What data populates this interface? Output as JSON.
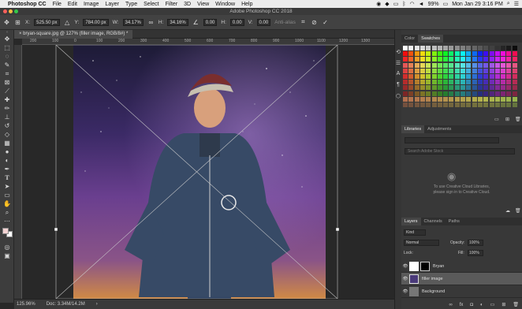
{
  "menubar": {
    "app": "Photoshop CC",
    "items": [
      "File",
      "Edit",
      "Image",
      "Layer",
      "Type",
      "Select",
      "Filter",
      "3D",
      "View",
      "Window",
      "Help"
    ],
    "battery": "99%",
    "clock": "Mon Jan 29  3:16 PM"
  },
  "window": {
    "title": "Adobe Photoshop CC 2018"
  },
  "options": {
    "x_label": "X:",
    "x_value": "525.50 px",
    "y_label": "Y:",
    "y_value": "784.00 px",
    "w_label": "W:",
    "w_value": "34.17%",
    "h_label": "H:",
    "h_value": "34.16%",
    "angle_value": "0.00",
    "h_skew_label": "H:",
    "h_skew_value": "0.00",
    "v_skew_label": "V:",
    "v_skew_value": "0.00",
    "interp_label": "Anti-alias"
  },
  "document": {
    "tab_label": "bryan-square.jpg @ 127% (filler image, RGB/8#) *",
    "zoom": "125.96%",
    "doc_size": "Doc: 3.34M/14.2M"
  },
  "rulers": {
    "h_ticks": [
      "200",
      "100",
      "0",
      "100",
      "200",
      "300",
      "400",
      "500",
      "600",
      "700",
      "800",
      "900",
      "1000",
      "1100",
      "1200",
      "1300"
    ]
  },
  "panels": {
    "color_tab": "Color",
    "swatches_tab": "Swatches",
    "libraries_tab": "Libraries",
    "adjustments_tab": "Adjustments",
    "search_placeholder": "Search Adobe Stock",
    "cc_message_1": "To use Creative Cloud Libraries,",
    "cc_message_2": "please sign in to Creative Cloud.",
    "layers_tab": "Layers",
    "channels_tab": "Channels",
    "paths_tab": "Paths",
    "kind_filter": "Kind",
    "blend_mode": "Normal",
    "opacity_label": "Opacity:",
    "opacity_value": "100%",
    "lock_label": "Lock:",
    "fill_label": "Fill:",
    "fill_value": "100%"
  },
  "layers": [
    {
      "name": "Bryan",
      "selected": false
    },
    {
      "name": "filler image",
      "selected": true
    },
    {
      "name": "Background",
      "selected": false
    }
  ],
  "tool_icons": [
    "move-icon",
    "marquee-icon",
    "lasso-icon",
    "quick-select-icon",
    "crop-icon",
    "eyedropper-icon",
    "healing-icon",
    "brush-icon",
    "stamp-icon",
    "history-brush-icon",
    "eraser-icon",
    "gradient-icon",
    "blur-icon",
    "dodge-icon",
    "pen-icon",
    "type-icon",
    "path-select-icon",
    "rectangle-icon",
    "hand-icon",
    "zoom-icon",
    "more-tools-icon"
  ],
  "colors": {
    "selected_layer": "#5a5a5a",
    "fg": "#f4d3d3",
    "bg": "#ffffff"
  }
}
